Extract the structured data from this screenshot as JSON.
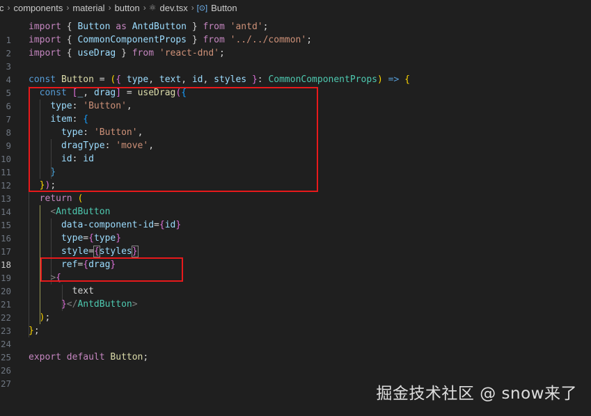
{
  "breadcrumb": {
    "items": [
      "c",
      "components",
      "material",
      "button",
      "dev.tsx",
      "Button"
    ]
  },
  "editor": {
    "active_line": 18,
    "lines": [
      {
        "n": "1"
      },
      {
        "n": "2"
      },
      {
        "n": "3"
      },
      {
        "n": "4"
      },
      {
        "n": "5"
      },
      {
        "n": "6"
      },
      {
        "n": "7"
      },
      {
        "n": "8"
      },
      {
        "n": "9"
      },
      {
        "n": "10"
      },
      {
        "n": "11"
      },
      {
        "n": "12"
      },
      {
        "n": "13"
      },
      {
        "n": "14"
      },
      {
        "n": "15"
      },
      {
        "n": "16"
      },
      {
        "n": "17"
      },
      {
        "n": "18"
      },
      {
        "n": "19"
      },
      {
        "n": "20"
      },
      {
        "n": "21"
      },
      {
        "n": "22"
      },
      {
        "n": "23"
      },
      {
        "n": "24"
      },
      {
        "n": "25"
      },
      {
        "n": "26"
      },
      {
        "n": "27"
      }
    ]
  },
  "code": {
    "l1": [
      "import",
      "{",
      "Button",
      "as",
      "AntdButton",
      "}",
      "from",
      "'antd'",
      ";"
    ],
    "l2": [
      "import",
      "{",
      "CommonComponentProps",
      "}",
      "from",
      "'../../common'",
      ";"
    ],
    "l3": [
      "import",
      "{",
      "useDrag",
      "}",
      "from",
      "'react-dnd'",
      ";"
    ],
    "l5": [
      "const",
      "Button",
      "=",
      "(",
      "{",
      "type",
      "text",
      "id",
      "styles",
      "}",
      ":",
      "CommonComponentProps",
      ")",
      "=>",
      "{"
    ],
    "l6": [
      "const",
      "[",
      "_",
      "drag",
      "]",
      "=",
      "useDrag",
      "(",
      "{"
    ],
    "l7": [
      "type",
      ":",
      "'Button'",
      ","
    ],
    "l8": [
      "item",
      ":",
      "{"
    ],
    "l9": [
      "type",
      ":",
      "'Button'",
      ","
    ],
    "l10": [
      "dragType",
      ":",
      "'move'",
      ","
    ],
    "l11": [
      "id",
      ":",
      "id"
    ],
    "l12": [
      "}"
    ],
    "l13": [
      "}",
      ")",
      ";"
    ],
    "l14": [
      "return",
      "("
    ],
    "l15": [
      "<",
      "AntdButton"
    ],
    "l16": [
      "data-component-id",
      "=",
      "{",
      "id",
      "}"
    ],
    "l17": [
      "type",
      "=",
      "{",
      "type",
      "}"
    ],
    "l18": [
      "style",
      "=",
      "{",
      "styles",
      "}"
    ],
    "l19": [
      "ref",
      "=",
      "{",
      "drag",
      "}"
    ],
    "l20": [
      ">",
      "{"
    ],
    "l21": [
      "text"
    ],
    "l22": [
      "}",
      "</",
      "AntdButton",
      ">"
    ],
    "l23": [
      ")",
      ";"
    ],
    "l24": [
      "}",
      ";"
    ],
    "l26": [
      "export",
      "default",
      "Button",
      ";"
    ]
  },
  "watermark": "掘金技术社区 @ snow来了",
  "colors": {
    "background": "#1f1f1f",
    "keyword": "#569cd6",
    "control_keyword": "#c586c0",
    "identifier": "#9cdcfe",
    "function": "#dcdcaa",
    "string": "#ce9178",
    "type": "#4ec9b0",
    "highlight_box": "#e8191b"
  },
  "icons": {
    "file": "react-file-icon",
    "symbol": "symbol-method-icon"
  }
}
